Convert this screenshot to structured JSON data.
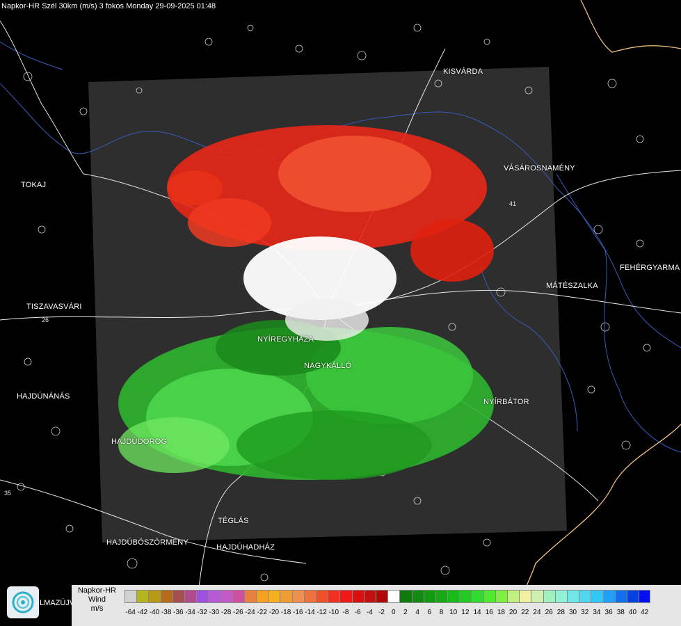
{
  "header": {
    "title": "Napkor-HR Szél 30km (m/s) 3 fokos Monday 29-09-2025 01:48"
  },
  "cities": [
    {
      "name": "KISVÁRDA",
      "key": "kisvarda"
    },
    {
      "name": "VÁSÁROSNAMÉNY",
      "key": "vasarosnameny"
    },
    {
      "name": "TOKAJ",
      "key": "tokaj"
    },
    {
      "name": "FEHÉRGYARMA",
      "key": "fehergyarmat"
    },
    {
      "name": "MÁTÉSZALKA",
      "key": "mateszalka"
    },
    {
      "name": "TISZAVASVÁRI",
      "key": "tiszavasvari"
    },
    {
      "name": "NYÍREGYHÁZA",
      "key": "nyiregyhaza"
    },
    {
      "name": "NAGYKÁLLÓ",
      "key": "nagykallo"
    },
    {
      "name": "HAJDÚNÁNÁS",
      "key": "hajdunanas"
    },
    {
      "name": "NYÍRBÁTOR",
      "key": "nyirbator"
    },
    {
      "name": "HAJDÚDOROG",
      "key": "hajdudorog"
    },
    {
      "name": "TÉGLÁS",
      "key": "teglas"
    },
    {
      "name": "HAJDÚBÖSZÖRMÉNY",
      "key": "hajduboszormeny"
    },
    {
      "name": "HAJDÚHADHÁZ",
      "key": "hajduhadhaz"
    }
  ],
  "road_labels": [
    "26",
    "41",
    "35"
  ],
  "legend": {
    "line1": "Napkor-HR",
    "line2": "Wind",
    "line3": "m/s",
    "ticks": [
      "-64",
      "-42",
      "-40",
      "-38",
      "-36",
      "-34",
      "-32",
      "-30",
      "-28",
      "-26",
      "-24",
      "-22",
      "-20",
      "-18",
      "-16",
      "-14",
      "-12",
      "-10",
      "-8",
      "-6",
      "-4",
      "-2",
      "0",
      "2",
      "4",
      "6",
      "8",
      "10",
      "12",
      "14",
      "16",
      "18",
      "20",
      "22",
      "24",
      "26",
      "28",
      "30",
      "32",
      "34",
      "36",
      "38",
      "40",
      "42"
    ],
    "colors": [
      "#d2d2d2",
      "#b5b51e",
      "#b89a16",
      "#b56c1a",
      "#a55050",
      "#b04c8c",
      "#a050e0",
      "#b85ad8",
      "#c45ac8",
      "#d050a0",
      "#e88040",
      "#f7a01e",
      "#f5b020",
      "#f09c30",
      "#f09050",
      "#f07040",
      "#f05028",
      "#f03020",
      "#f01818",
      "#d81010",
      "#c01010",
      "#b00808",
      "#ffffff",
      "#0e7a0e",
      "#108a10",
      "#129a12",
      "#14aa14",
      "#18bc18",
      "#20cc20",
      "#30dc30",
      "#50e830",
      "#80f040",
      "#c0f080",
      "#f0f0a0",
      "#d0f0b0",
      "#a0f0c0",
      "#90f0d8",
      "#70e8e8",
      "#50d8f0",
      "#30c8f8",
      "#20a0f8",
      "#1070f0",
      "#0840e0",
      "#0010f0"
    ]
  },
  "branding": {
    "logo_text": "LMAZÚJVÁR"
  }
}
